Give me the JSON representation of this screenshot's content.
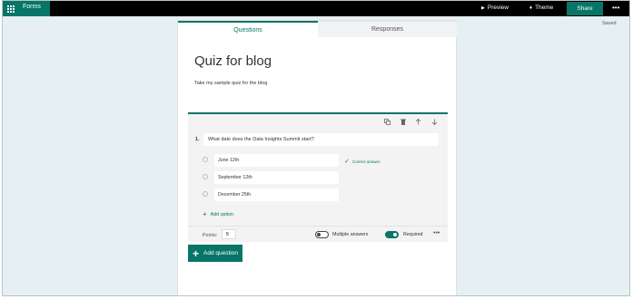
{
  "topbar": {
    "app_name": "Forms",
    "preview_label": "Preview",
    "theme_label": "Theme",
    "share_label": "Share",
    "more_label": "•••",
    "accent_color": "#077568"
  },
  "status": {
    "saved_label": "Saved"
  },
  "tabs": [
    {
      "label": "Questions",
      "active": true
    },
    {
      "label": "Responses",
      "active": false
    }
  ],
  "form": {
    "title": "Quiz for blog",
    "description": "Take my sample quiz for the blog"
  },
  "question": {
    "number": "1.",
    "text": "What date does the Data Insights Summit start?",
    "toolbar_icons": [
      "copy-icon",
      "trash-icon",
      "arrow-up-icon",
      "arrow-down-icon"
    ],
    "options": [
      {
        "text": "June 12th",
        "correct": true
      },
      {
        "text": "September 12th",
        "correct": false
      },
      {
        "text": "December 25th",
        "correct": false
      }
    ],
    "correct_answer_label": "Correct answer",
    "add_option_label": "Add option",
    "points_label": "Points:",
    "points_value": "5",
    "multiple_answers_label": "Multiple answers",
    "multiple_answers_on": false,
    "required_label": "Required",
    "required_on": true,
    "more_label": "•••"
  },
  "add_question_label": "Add question"
}
